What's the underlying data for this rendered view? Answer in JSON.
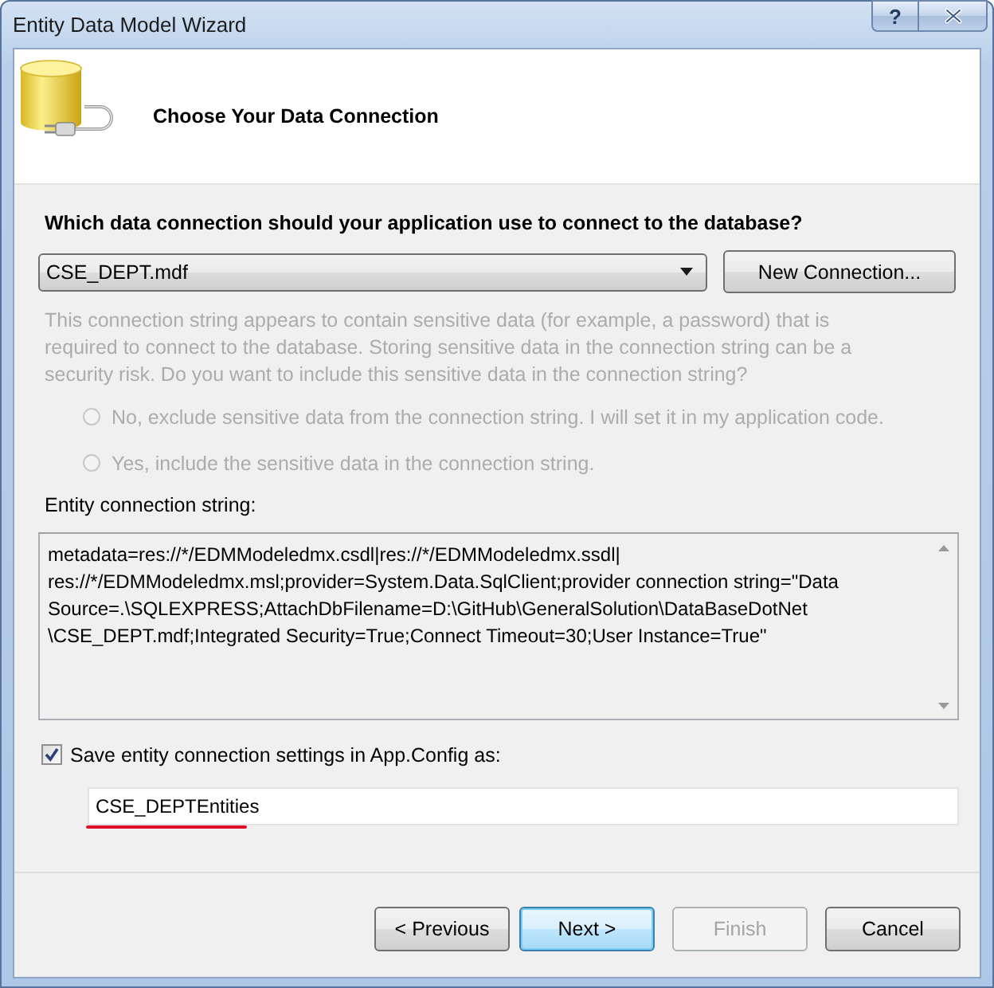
{
  "window": {
    "title": "Entity Data Model Wizard",
    "help_button": "?"
  },
  "header": {
    "title": "Choose Your Data Connection"
  },
  "question": "Which data connection should your application use to connect to the database?",
  "connection": {
    "value": "CSE_DEPT.mdf",
    "new_connection_button": "New Connection..."
  },
  "sensitive_note": {
    "text": "This connection string appears to contain sensitive data (for example, a password) that is required to connect to the database. Storing sensitive data in the connection string can be a security risk. Do you want to include this sensitive data in the connection string?",
    "disabled": true
  },
  "sensitive_options": [
    {
      "label": "No, exclude sensitive data from the connection string. I will set it in my application code.",
      "selected": false,
      "disabled": true
    },
    {
      "label": "Yes, include the sensitive data in the connection string.",
      "selected": false,
      "disabled": true
    }
  ],
  "connection_string": {
    "label": "Entity connection string:",
    "lines": [
      "metadata=res://*/EDMModeledmx.csdl|res://*/EDMModeledmx.ssdl|",
      "res://*/EDMModeledmx.msl;provider=System.Data.SqlClient;provider connection string=\"Data",
      "Source=.\\SQLEXPRESS;AttachDbFilename=D:\\GitHub\\GeneralSolution\\DataBaseDotNet",
      "\\CSE_DEPT.mdf;Integrated Security=True;Connect Timeout=30;User Instance=True\""
    ]
  },
  "save_settings": {
    "label": "Save entity connection settings in App.Config as:",
    "checked": true,
    "value": "CSE_DEPTEntities",
    "underlined": true
  },
  "buttons": [
    {
      "label": "< Previous",
      "disabled": false,
      "focused": false
    },
    {
      "label": "Next >",
      "disabled": false,
      "focused": true
    },
    {
      "label": "Finish",
      "disabled": true,
      "focused": false
    },
    {
      "label": "Cancel",
      "disabled": false,
      "focused": false
    }
  ]
}
